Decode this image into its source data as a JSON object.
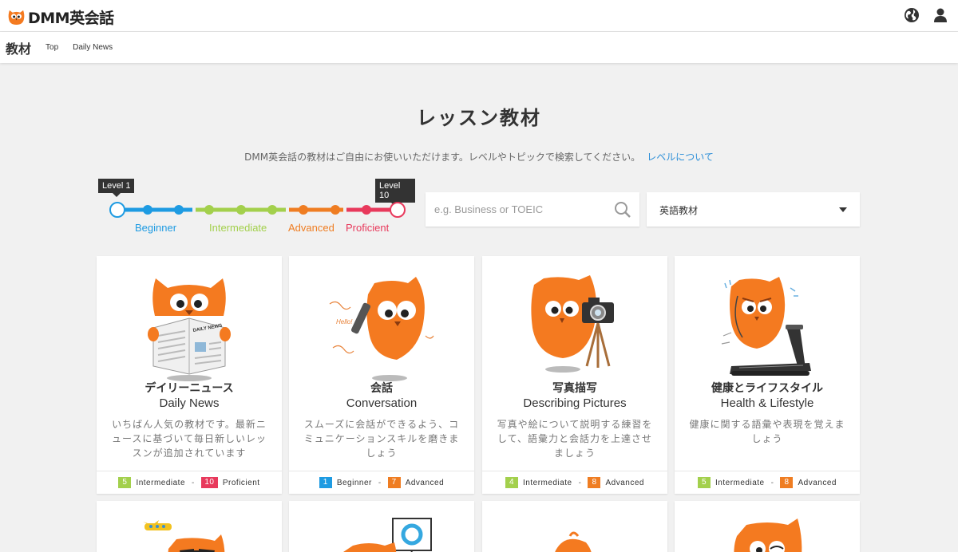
{
  "header": {
    "brand": "DMM英会話",
    "icons": [
      "globe-icon",
      "user-icon"
    ]
  },
  "subnav": {
    "title": "教材",
    "links": [
      "Top",
      "Daily News"
    ]
  },
  "page": {
    "title": "レッスン教材",
    "subtitle": "DMM英会話の教材はご自由にお使いいただけます。レベルやトピックで検索してください。",
    "level_link": "レベルについて"
  },
  "level_bar": {
    "min_label": "Level 1",
    "max_label": "Level 10",
    "groups": [
      {
        "name": "Beginner",
        "color": "#1e9be2"
      },
      {
        "name": "Intermediate",
        "color": "#a3d04c"
      },
      {
        "name": "Advanced",
        "color": "#ef7d22"
      },
      {
        "name": "Proficient",
        "color": "#e8395c"
      }
    ]
  },
  "search": {
    "placeholder": "e.g. Business or TOEIC",
    "icon": "search-icon"
  },
  "select": {
    "value": "英語教材"
  },
  "colors": {
    "owl": "#f47a20",
    "beginner": "#1e9be2",
    "intermediate": "#a3d04c",
    "advanced": "#ef7d22",
    "proficient": "#e8395c"
  },
  "cards": [
    {
      "ja": "デイリーニュース",
      "en": "Daily News",
      "desc": "いちばん人気の教材です。最新ニュースに基づいて毎日新しいレッスンが追加されています",
      "from": {
        "num": "5",
        "label": "Intermediate"
      },
      "to": {
        "num": "10",
        "label": "Proficient"
      }
    },
    {
      "ja": "会話",
      "en": "Conversation",
      "desc": "スムーズに会話ができるよう、コミュニケーションスキルを磨きましょう",
      "from": {
        "num": "1",
        "label": "Beginner"
      },
      "to": {
        "num": "7",
        "label": "Advanced"
      },
      "illus_text": "Hello!"
    },
    {
      "ja": "写真描写",
      "en": "Describing Pictures",
      "desc": "写真や絵について説明する練習をして、語彙力と会話力を上達させましょう",
      "from": {
        "num": "4",
        "label": "Intermediate"
      },
      "to": {
        "num": "8",
        "label": "Advanced"
      }
    },
    {
      "ja": "健康とライフスタイル",
      "en": "Health & Lifestyle",
      "desc": "健康に関する語彙や表現を覚えましょう",
      "from": {
        "num": "5",
        "label": "Intermediate"
      },
      "to": {
        "num": "8",
        "label": "Advanced"
      }
    }
  ]
}
